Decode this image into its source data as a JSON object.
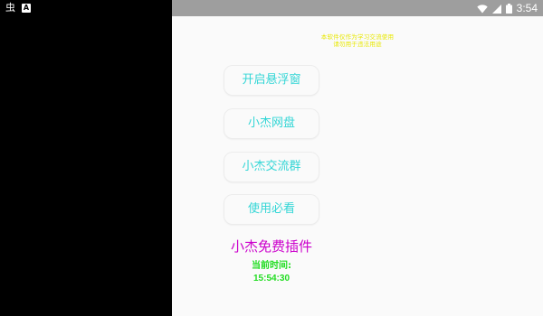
{
  "status_bar": {
    "left_icons": [
      "bug-icon",
      "a-letter-icon"
    ],
    "bug_glyph": "虫",
    "a_glyph": "A",
    "right_icons": [
      "wifi-icon",
      "signal-icon",
      "battery-icon"
    ],
    "time": "3:54"
  },
  "app": {
    "notice_lines": [
      "本软件仅作为学习交流使用",
      "请勿用于违法用途"
    ],
    "buttons": [
      {
        "label": "开启悬浮窗"
      },
      {
        "label": "小杰网盘"
      },
      {
        "label": "小杰交流群"
      },
      {
        "label": "使用必看"
      }
    ],
    "plugin_title": "小杰免费插件",
    "time_label": "当前时间:",
    "time_value": "15:54:30"
  },
  "colors": {
    "status_bar_right": "#9e9e9e",
    "notice_text": "#e8e800",
    "button_text": "#33d6d6",
    "plugin_title": "#cc00cc",
    "time_text": "#22dd22",
    "app_background": "#fafafa"
  }
}
